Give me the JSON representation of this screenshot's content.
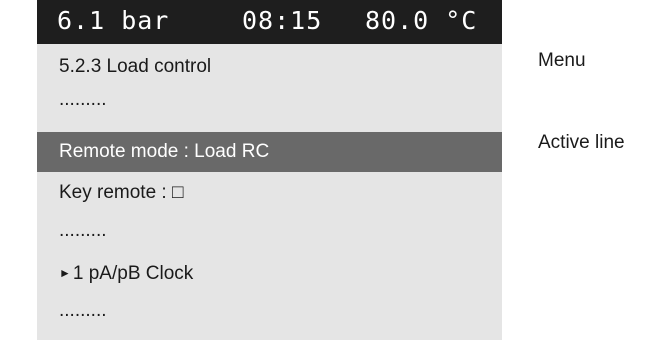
{
  "status": {
    "pressure": "6.1 bar",
    "time": "08:15",
    "temperature": "80.0 °C"
  },
  "menu": {
    "lines": [
      "5.2.3 Load control",
      ".........",
      "Remote mode : Load RC",
      "Key remote : □",
      ".........",
      "1 pA/pB Clock",
      "........."
    ],
    "submenu_arrow": "►",
    "active_index": 2
  },
  "annotations": {
    "menu": "Menu",
    "active_line": "Active line"
  },
  "colors": {
    "status_bg": "#1e1e1e",
    "panel_bg": "#e5e5e5",
    "active_bg": "#696969"
  }
}
